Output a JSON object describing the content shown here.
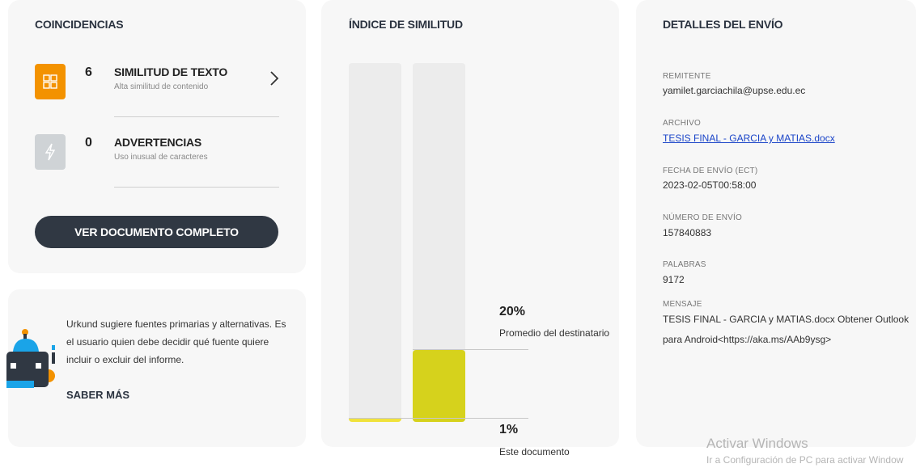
{
  "coincidencias": {
    "heading": "COINCIDENCIAS",
    "items": [
      {
        "count": "6",
        "title": "SIMILITUD DE TEXTO",
        "subtitle": "Alta similitud de contenido"
      },
      {
        "count": "0",
        "title": "ADVERTENCIAS",
        "subtitle": "Uso inusual de caracteres"
      }
    ],
    "button_label": "VER DOCUMENTO COMPLETO"
  },
  "info": {
    "text": "Urkund sugiere fuentes primarias y alternativas. Es el usuario quien debe decidir qué fuente quiere incluir o excluir del informe.",
    "link_label": "SABER MÁS"
  },
  "indice": {
    "heading": "ÍNDICE DE SIMILITUD",
    "average_pct": "20%",
    "average_label": "Promedio del destinatario",
    "average_value": 20,
    "document_pct": "1%",
    "document_label": "Este documento",
    "document_value": 1
  },
  "detalles": {
    "heading": "DETALLES DEL ENVÍO",
    "fields": [
      {
        "label": "REMITENTE",
        "value": "yamilet.garciachila@upse.edu.ec"
      },
      {
        "label": "ARCHIVO",
        "value": "TESIS FINAL - GARCIA y MATIAS.docx"
      },
      {
        "label": "FECHA DE ENVÍO (ECT)",
        "value": "2023-02-05T00:58:00"
      },
      {
        "label": "NÚMERO DE ENVÍO",
        "value": "157840883"
      },
      {
        "label": "PALABRAS",
        "value": "9172"
      },
      {
        "label": "MENSAJE",
        "value_line1": "TESIS FINAL - GARCIA y MATIAS.docx Obtener Outlook",
        "value_line2": "para Android<https://aka.ms/AAb9ysg>"
      }
    ]
  },
  "watermark": {
    "line1": "Activar Windows",
    "line2": "Ir a Configuración de PC para activar Window"
  },
  "colors": {
    "orange": "#f39200",
    "gray_icon": "#cfd3d6",
    "dark_button": "#303843",
    "yellow_bar": "#d6d21c",
    "link": "#1a44c8"
  }
}
